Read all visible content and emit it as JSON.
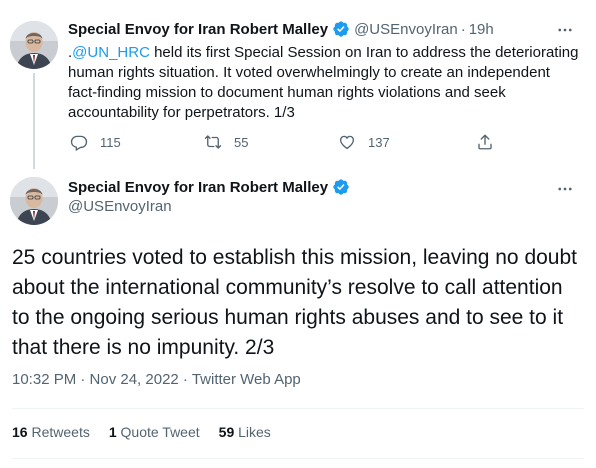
{
  "tweet1": {
    "display_name": "Special Envoy for Iran Robert Malley",
    "handle": "@USEnvoyIran",
    "separator": "·",
    "time": "19h",
    "text_prefix": ".",
    "mention": "@UN_HRC",
    "text_body": " held its first Special Session on Iran to address the deteriorating human rights situation. It voted overwhelmingly to create an independent fact-finding mission to document human rights violations and seek accountability for perpetrators. 1/3",
    "replies": "115",
    "retweets": "55",
    "likes": "137",
    "icons": {
      "verified": "verified-badge-icon",
      "more": "more-icon",
      "reply": "reply-icon",
      "retweet": "retweet-icon",
      "like": "heart-icon",
      "share": "share-icon"
    }
  },
  "tweet2": {
    "display_name": "Special Envoy for Iran Robert Malley",
    "handle": "@USEnvoyIran",
    "text": "25 countries voted to establish this mission, leaving no doubt about the international community’s resolve to call attention to the ongoing serious human rights abuses and to see to it that there is no impunity. 2/3",
    "meta": "10:32 PM · Nov 24, 2022 · Twitter Web App",
    "stats": {
      "retweets_count": "16",
      "retweets_label": "Retweets",
      "quotes_count": "1",
      "quotes_label": "Quote Tweet",
      "likes_count": "59",
      "likes_label": "Likes"
    }
  },
  "colors": {
    "accent": "#1d9bf0",
    "text_primary": "#0f1419",
    "text_secondary": "#536471",
    "divider": "#eff3f4"
  }
}
